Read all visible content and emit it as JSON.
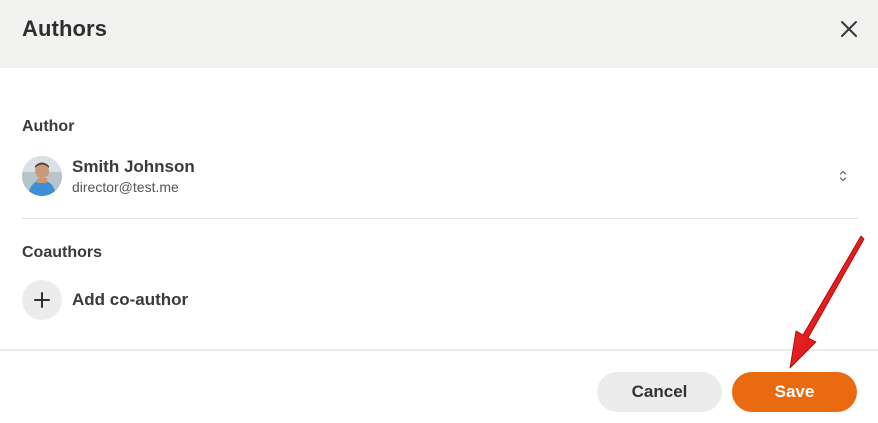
{
  "dialog": {
    "title": "Authors",
    "close_icon": "close-icon"
  },
  "author": {
    "section_label": "Author",
    "name": "Smith Johnson",
    "email": "director@test.me",
    "avatar_icon": "avatar",
    "chevron_icon": "select-chevron-icon"
  },
  "coauthors": {
    "section_label": "Coauthors",
    "add_label": "Add co-author",
    "add_icon": "plus-icon"
  },
  "footer": {
    "cancel_label": "Cancel",
    "save_label": "Save"
  },
  "colors": {
    "header_bg": "#f2f2f1",
    "accent": "#ea6a10",
    "annotation_arrow": "#e00000"
  }
}
